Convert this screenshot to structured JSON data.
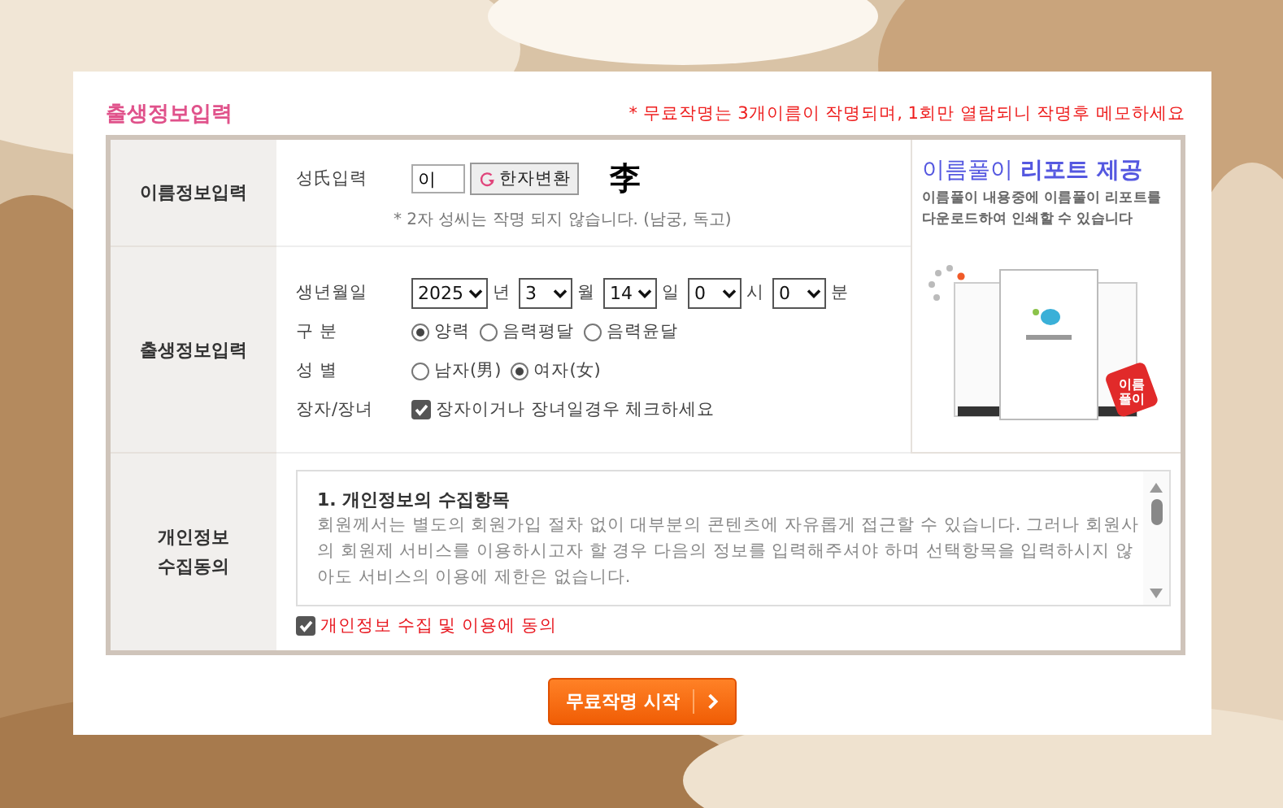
{
  "title": "출생정보입력",
  "notice": "* 무료작명는 3개이름이 작명되며, 1회만 열람되니 작명후 메모하세요",
  "name_section": {
    "label": "이름정보입력",
    "field_label": "성氏입력",
    "surname_value": "이",
    "convert_button": "한자변환",
    "hanja": "李",
    "hint": "* 2자 성씨는 작명 되지 않습니다. (남궁, 독고)"
  },
  "ad": {
    "title_plain": "이름풀이",
    "title_bold": "리포트 제공",
    "text": "이름풀이 내용중에 이름풀이 리포트를 다운로드하여 인쇄할 수 있습니다",
    "badge": "이름풀이"
  },
  "birth_section": {
    "label": "출생정보입력",
    "date": {
      "label": "생년월일",
      "parts": [
        {
          "value": "2025",
          "unit": "년"
        },
        {
          "value": "3",
          "unit": "월"
        },
        {
          "value": "14",
          "unit": "일"
        },
        {
          "value": "0",
          "unit": "시"
        },
        {
          "value": "0",
          "unit": "분"
        }
      ]
    },
    "calendar": {
      "label": "구 분",
      "options": [
        {
          "label": "양력",
          "selected": true
        },
        {
          "label": "음력평달",
          "selected": false
        },
        {
          "label": "음력윤달",
          "selected": false
        }
      ]
    },
    "gender": {
      "label": "성 별",
      "options": [
        {
          "label": "남자(男)",
          "selected": false
        },
        {
          "label": "여자(女)",
          "selected": true
        }
      ]
    },
    "eldest": {
      "label": "장자/장녀",
      "text": "장자이거나 장녀일경우 체크하세요",
      "checked": true
    }
  },
  "consent_section": {
    "label_lines": [
      "개인정보",
      "수집동의"
    ],
    "heading": "1. 개인정보의 수집항목",
    "body": "회원께서는 별도의 회원가입 절차 없이 대부분의 콘텐츠에 자유롭게 접근할 수 있습니다. 그러나 회원사의 회원제 서비스를 이용하시고자 할 경우 다음의 정보를 입력해주셔야 하며 선택항목을 입력하시지 않아도 서비스의 이용에 제한은 없습니다.",
    "agree_text": "개인정보 수집 및 이용에 동의",
    "agree_checked": true
  },
  "submit_button": "무료작명 시작"
}
